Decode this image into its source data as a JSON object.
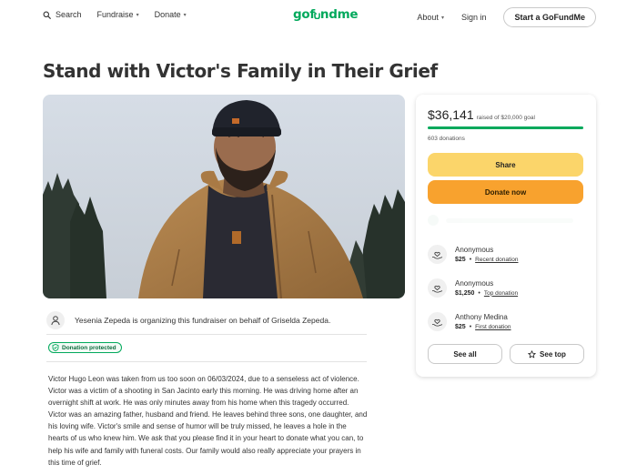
{
  "header": {
    "search_label": "Search",
    "fundraise_label": "Fundraise",
    "donate_label": "Donate",
    "logo_text_left": "gof",
    "logo_text_right": "ndme",
    "about_label": "About",
    "signin_label": "Sign in",
    "start_label": "Start a GoFundMe"
  },
  "campaign": {
    "title": "Stand with Victor's Family in Their Grief",
    "organizer_text": "Yesenia Zepeda is organizing this fundraiser on behalf of Griselda Zepeda.",
    "badge_label": "Donation protected",
    "story": "Victor Hugo Leon was taken from us too soon on 06/03/2024, due to a senseless act of violence. Victor was a victim of a shooting in San Jacinto early this morning. He was driving home after an overnight shift at work. He was only minutes away from his home when this tragedy occurred. Victor was an amazing father, husband and friend. He leaves behind three sons, one daughter, and his loving wife. Victor's smile and sense of humor will be truly missed, he leaves a hole in the hearts of us who knew him. We ask that you please find it in your heart to donate what you can, to help his wife and family with funeral costs. Our family would also really appreciate your prayers in this time of grief."
  },
  "donate_card": {
    "amount": "$36,141",
    "goal_text": "raised of $20,000 goal",
    "progress_fraction": 1.0,
    "donations_count": "603 donations",
    "share_label": "Share",
    "donate_label": "Donate now",
    "donations": [
      {
        "name": "Anonymous",
        "amount": "$25",
        "tag": "Recent donation"
      },
      {
        "name": "Anonymous",
        "amount": "$1,250",
        "tag": "Top donation"
      },
      {
        "name": "Anthony Medina",
        "amount": "$25",
        "tag": "First donation"
      }
    ],
    "see_all_label": "See all",
    "see_top_label": "See top"
  },
  "colors": {
    "brand_green": "#02a95c",
    "share_yellow": "#fbd56a",
    "donate_orange": "#f8a22e"
  },
  "icons": {
    "search": "search-icon",
    "caret": "chevron-down-icon",
    "organizer": "user-icon",
    "badge": "shield-check-icon",
    "donor": "hand-heart-icon",
    "see_top": "star-icon"
  }
}
